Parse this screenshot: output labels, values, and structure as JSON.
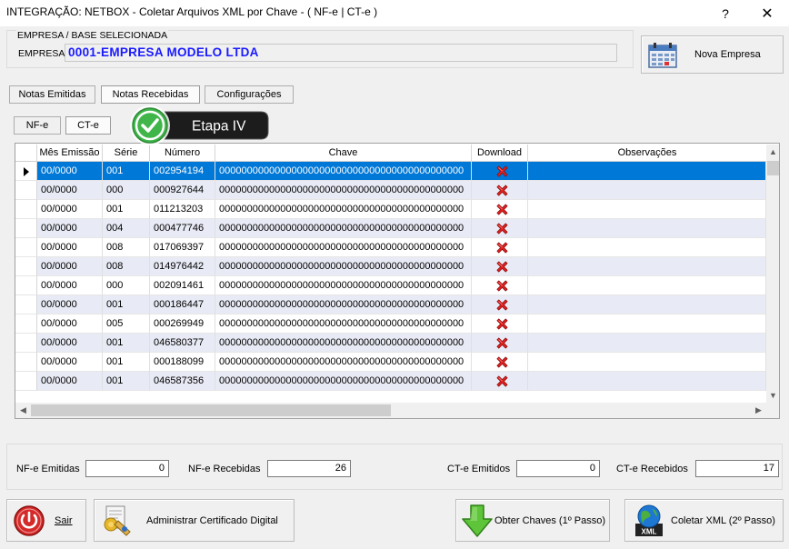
{
  "window": {
    "title": "INTEGRAÇÃO: NETBOX - Coletar Arquivos XML por Chave - ( NF-e | CT-e )",
    "help_label": "?",
    "close_label": "✕"
  },
  "empresa": {
    "group_label": "EMPRESA  /  BASE  SELECIONADA",
    "label": "EMPRESA",
    "value": "0001-EMPRESA MODELO LTDA"
  },
  "nova_empresa": {
    "label": "Nova Empresa",
    "icon": "calendar-icon"
  },
  "tabs": [
    {
      "label": "Notas Emitidas",
      "active": false
    },
    {
      "label": "Notas Recebidas",
      "active": true
    },
    {
      "label": "Configurações",
      "active": false
    }
  ],
  "subtabs": [
    {
      "label": "NF-e",
      "active": false
    },
    {
      "label": "CT-e",
      "active": true
    }
  ],
  "etapa": {
    "label": "Etapa IV",
    "icon": "check-circle-icon"
  },
  "grid": {
    "columns": [
      "Mês Emissão",
      "Série",
      "Número",
      "Chave",
      "Download",
      "Observações"
    ],
    "rows": [
      {
        "mes": "00/0000",
        "serie": "001",
        "numero": "002954194",
        "chave": "00000000000000000000000000000000000000000000",
        "obs": ""
      },
      {
        "mes": "00/0000",
        "serie": "000",
        "numero": "000927644",
        "chave": "00000000000000000000000000000000000000000000",
        "obs": ""
      },
      {
        "mes": "00/0000",
        "serie": "001",
        "numero": "011213203",
        "chave": "00000000000000000000000000000000000000000000",
        "obs": ""
      },
      {
        "mes": "00/0000",
        "serie": "004",
        "numero": "000477746",
        "chave": "00000000000000000000000000000000000000000000",
        "obs": ""
      },
      {
        "mes": "00/0000",
        "serie": "008",
        "numero": "017069397",
        "chave": "00000000000000000000000000000000000000000000",
        "obs": ""
      },
      {
        "mes": "00/0000",
        "serie": "008",
        "numero": "014976442",
        "chave": "00000000000000000000000000000000000000000000",
        "obs": ""
      },
      {
        "mes": "00/0000",
        "serie": "000",
        "numero": "002091461",
        "chave": "00000000000000000000000000000000000000000000",
        "obs": ""
      },
      {
        "mes": "00/0000",
        "serie": "001",
        "numero": "000186447",
        "chave": "00000000000000000000000000000000000000000000",
        "obs": ""
      },
      {
        "mes": "00/0000",
        "serie": "005",
        "numero": "000269949",
        "chave": "00000000000000000000000000000000000000000000",
        "obs": ""
      },
      {
        "mes": "00/0000",
        "serie": "001",
        "numero": "046580377",
        "chave": "00000000000000000000000000000000000000000000",
        "obs": ""
      },
      {
        "mes": "00/0000",
        "serie": "001",
        "numero": "000188099",
        "chave": "00000000000000000000000000000000000000000000",
        "obs": ""
      },
      {
        "mes": "00/0000",
        "serie": "001",
        "numero": "046587356",
        "chave": "00000000000000000000000000000000000000000000",
        "obs": ""
      }
    ],
    "download_icon": "red-x-icon",
    "selected_row": 0
  },
  "totals": {
    "nfe_emitidas": {
      "label": "NF-e Emitidas",
      "value": "0"
    },
    "nfe_recebidas": {
      "label": "NF-e Recebidas",
      "value": "26"
    },
    "cte_emitidos": {
      "label": "CT-e Emitidos",
      "value": "0"
    },
    "cte_recebidos": {
      "label": "CT-e Recebidos",
      "value": "17"
    }
  },
  "buttons": {
    "sair": "Sair",
    "certificado": "Administrar Certificado Digital",
    "obter": "Obter Chaves (1º Passo)",
    "coletar": "Coletar XML (2º Passo)",
    "xml_badge": "XML"
  },
  "colors": {
    "selected": "#0078d7",
    "alt_row": "#e8ebf5",
    "empresa_text": "#1a1aff",
    "etapa_bg": "#1c1c1c",
    "check_green": "#3fb54a"
  }
}
